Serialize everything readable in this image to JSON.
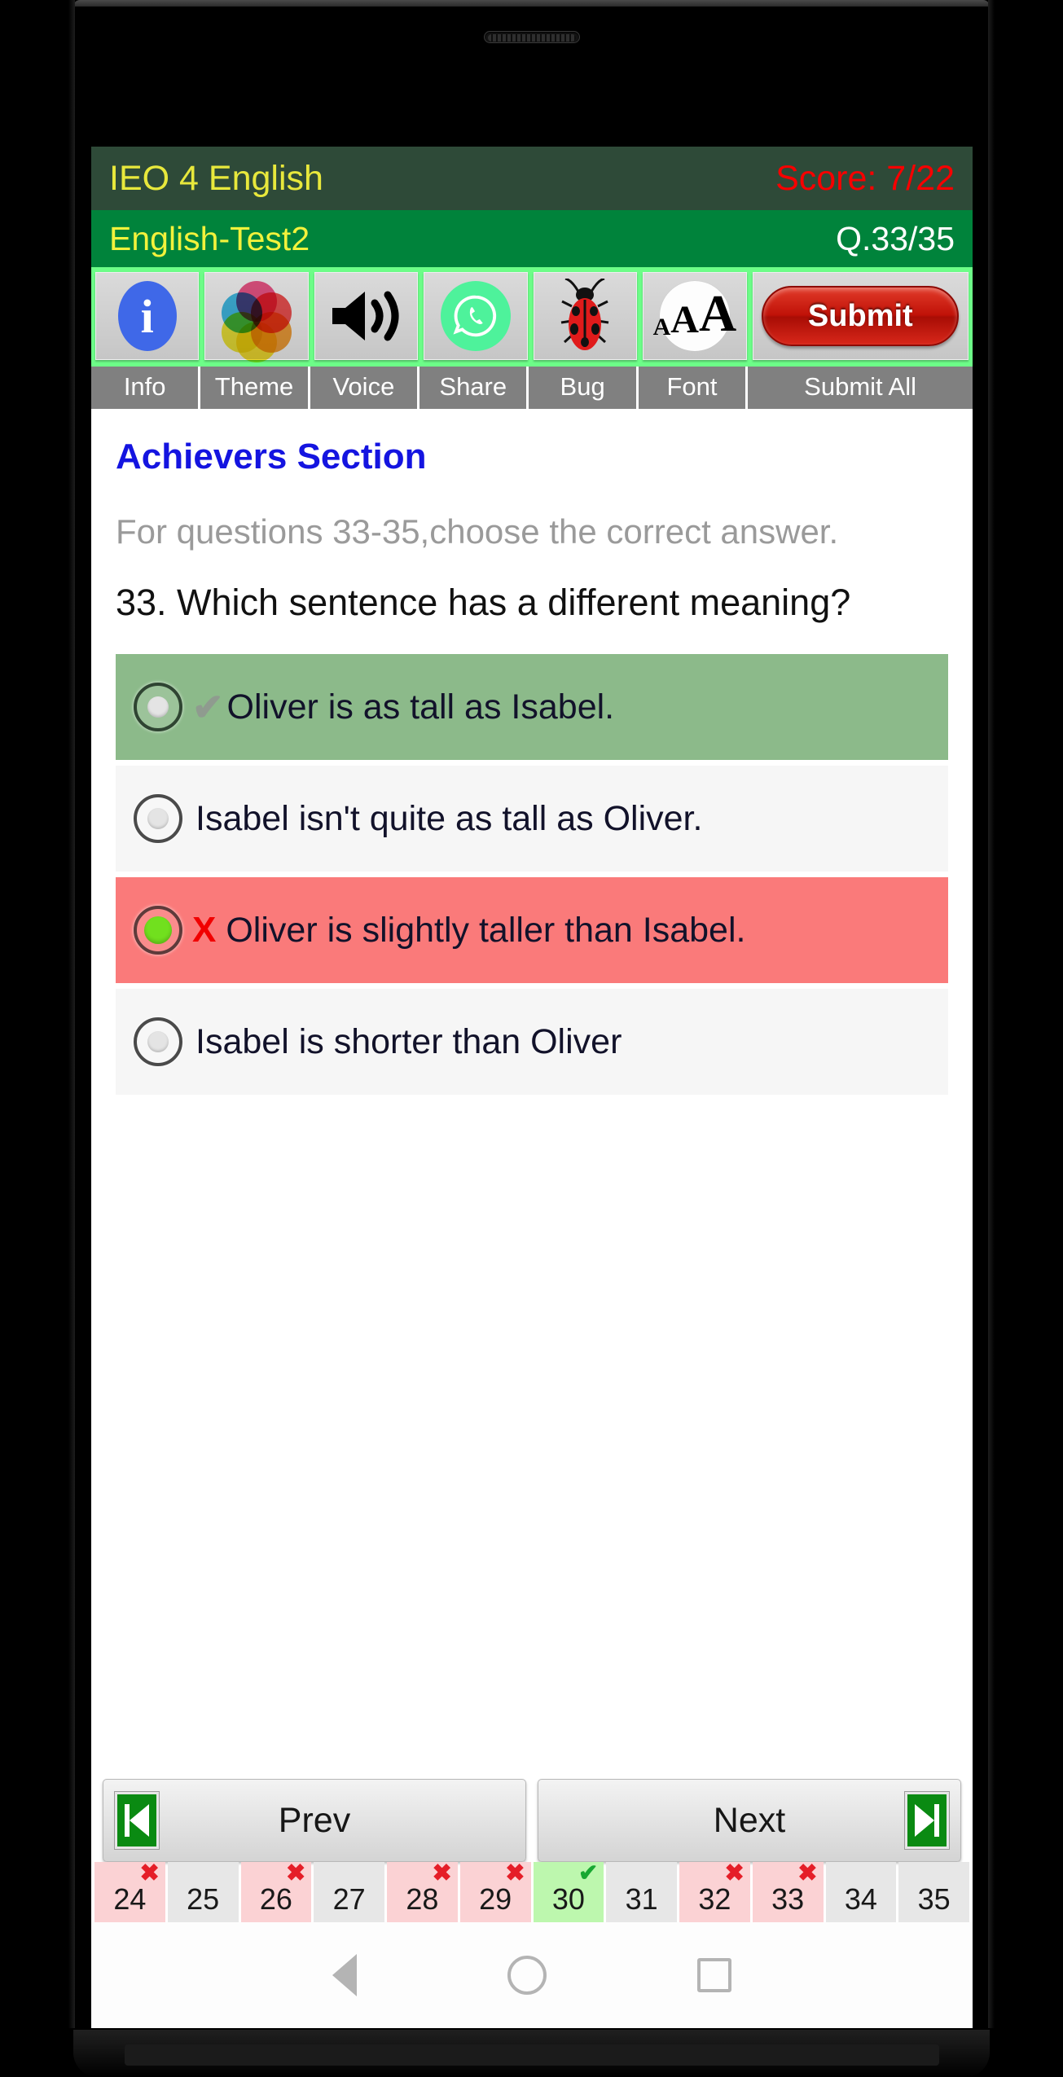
{
  "app": {
    "title": "IEO 4 English",
    "score_label": "Score: 7/22",
    "test_name": "English-Test2",
    "question_counter": "Q.33/35"
  },
  "colors": {
    "title_bar_bg": "#2e4a38",
    "sub_bar_bg": "#00833b",
    "title_text": "#e8e83c",
    "score_text": "#f70000",
    "toolbar_bg": "#6dfd88",
    "section_title": "#1414e0",
    "correct_row": "#8cba8a",
    "wrong_row": "#fa7a7a",
    "neutral_row": "#f6f6f6",
    "submit_red": "#c01208"
  },
  "toolbar": {
    "items": [
      {
        "icon": "info-icon",
        "label": "Info"
      },
      {
        "icon": "theme-icon",
        "label": "Theme"
      },
      {
        "icon": "voice-icon",
        "label": "Voice"
      },
      {
        "icon": "share-icon",
        "label": "Share"
      },
      {
        "icon": "bug-icon",
        "label": "Bug"
      },
      {
        "icon": "font-icon",
        "label": "Font"
      },
      {
        "icon": "submit-icon",
        "label": "Submit All"
      }
    ],
    "font_icon_text": "AAA",
    "info_icon_text": "i",
    "submit_button_label": "Submit"
  },
  "content": {
    "section_title": "Achievers Section",
    "instruction": "For questions 33-35,choose the correct answer.",
    "question": "33. Which sentence has a different meaning?",
    "options": [
      {
        "text": "Oliver is as tall as Isabel.",
        "state": "correct",
        "mark": "✔",
        "selected": false
      },
      {
        "text": "Isabel isn't quite as tall as Oliver.",
        "state": "neutral",
        "mark": "",
        "selected": false
      },
      {
        "text": "Oliver is slightly taller than Isabel.",
        "state": "wrong",
        "mark": "X",
        "selected": true
      },
      {
        "text": "Isabel is shorter than Oliver",
        "state": "neutral",
        "mark": "",
        "selected": false
      }
    ]
  },
  "navigation": {
    "prev_label": "Prev",
    "next_label": "Next"
  },
  "question_strip": [
    {
      "num": "24",
      "state": "wrongq",
      "badge": "✖"
    },
    {
      "num": "25",
      "state": "neutral",
      "badge": ""
    },
    {
      "num": "26",
      "state": "wrongq",
      "badge": "✖"
    },
    {
      "num": "27",
      "state": "neutral",
      "badge": ""
    },
    {
      "num": "28",
      "state": "wrongq",
      "badge": "✖"
    },
    {
      "num": "29",
      "state": "wrongq",
      "badge": "✖"
    },
    {
      "num": "30",
      "state": "rightq",
      "badge": "✔"
    },
    {
      "num": "31",
      "state": "neutral",
      "badge": ""
    },
    {
      "num": "32",
      "state": "wrongq",
      "badge": "✖"
    },
    {
      "num": "33",
      "state": "wrongq",
      "badge": "✖"
    },
    {
      "num": "34",
      "state": "neutral",
      "badge": ""
    },
    {
      "num": "35",
      "state": "neutral",
      "badge": ""
    }
  ],
  "system_nav": {
    "back": "back-triangle-icon",
    "home": "home-circle-icon",
    "recents": "recents-square-icon"
  }
}
